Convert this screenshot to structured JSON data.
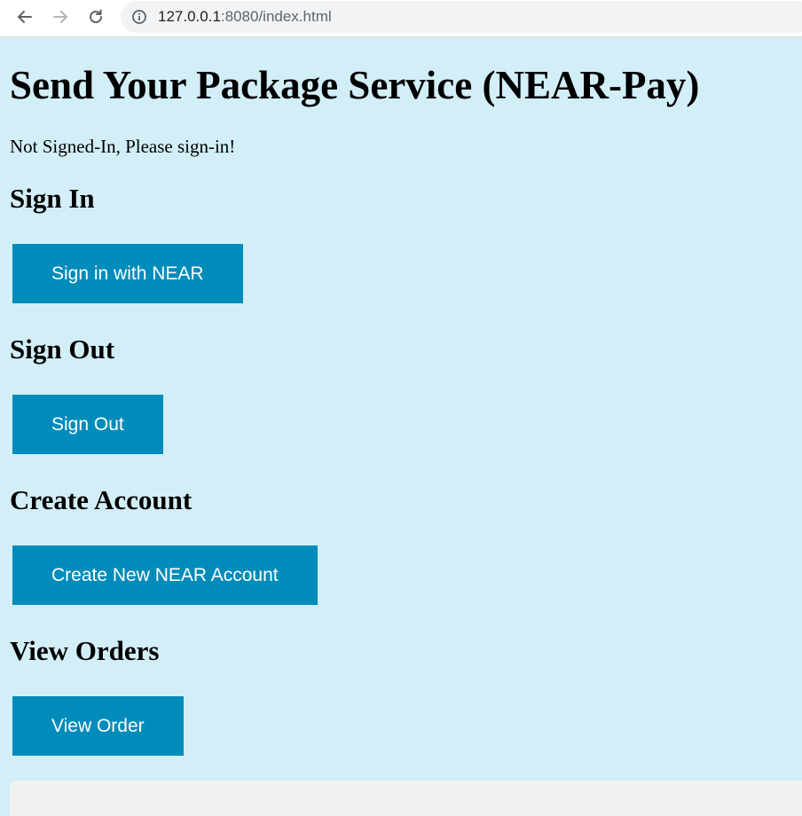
{
  "browser": {
    "url_host": "127.0.0.1",
    "url_path": ":8080/index.html",
    "icons": {
      "back": "back-arrow-icon",
      "forward": "forward-arrow-icon",
      "reload": "reload-icon",
      "info": "info-icon"
    }
  },
  "page": {
    "title": "Send Your Package Service (NEAR-Pay)",
    "status": "Not Signed-In, Please sign-in!",
    "sections": {
      "sign_in": {
        "heading": "Sign In",
        "button_label": "Sign in with NEAR"
      },
      "sign_out": {
        "heading": "Sign Out",
        "button_label": "Sign Out"
      },
      "create_account": {
        "heading": "Create Account",
        "button_label": "Create New NEAR Account"
      },
      "view_orders": {
        "heading": "View Orders",
        "button_label": "View Order"
      }
    }
  },
  "colors": {
    "page_background": "#d2eef7",
    "button_background": "#008cba",
    "button_text": "#ffffff"
  }
}
